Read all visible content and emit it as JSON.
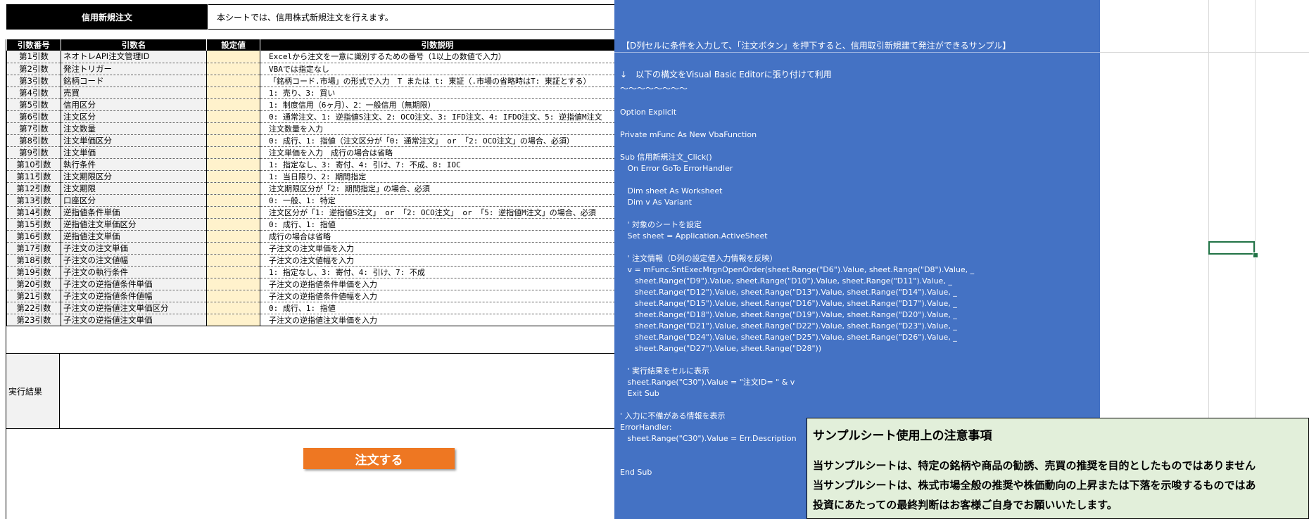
{
  "header": {
    "title": "信用新規注文",
    "description": "本シートでは、信用株式新規注文を行えます。"
  },
  "table": {
    "columns": [
      "引数番号",
      "引数名",
      "設定値",
      "引数説明"
    ],
    "rows": [
      {
        "num": "第1引数",
        "name": "ネオトレAPI注文管理ID",
        "value": "",
        "desc": "Excelから注文を一意に識別するための番号（1以上の数値で入力）"
      },
      {
        "num": "第2引数",
        "name": "発注トリガー",
        "value": "",
        "desc": "VBAでは指定なし"
      },
      {
        "num": "第3引数",
        "name": "銘柄コード",
        "value": "",
        "desc": "「銘柄コード.市場」の形式で入力　T または t: 東証（.市場の省略時はT: 東証とする）"
      },
      {
        "num": "第4引数",
        "name": "売買",
        "value": "",
        "desc": "1: 売り、3: 買い"
      },
      {
        "num": "第5引数",
        "name": "信用区分",
        "value": "",
        "desc": "1: 制度信用（6ヶ月）、2：一般信用（無期限）"
      },
      {
        "num": "第6引数",
        "name": "注文区分",
        "value": "",
        "desc": "0: 通常注文、1: 逆指値S注文、2: OCO注文、3: IFD注文、4: IFDO注文、5: 逆指値M注文"
      },
      {
        "num": "第7引数",
        "name": "注文数量",
        "value": "",
        "desc": "注文数量を入力"
      },
      {
        "num": "第8引数",
        "name": "注文単価区分",
        "value": "",
        "desc": "0: 成行、1: 指値（注文区分が「0: 通常注文」 or 「2: OCO注文」の場合、必須）"
      },
      {
        "num": "第9引数",
        "name": "注文単価",
        "value": "",
        "desc": "注文単価を入力　成行の場合は省略"
      },
      {
        "num": "第10引数",
        "name": "執行条件",
        "value": "",
        "desc": "1: 指定なし、3: 寄付、4: 引け、7: 不成、8: IOC"
      },
      {
        "num": "第11引数",
        "name": "注文期限区分",
        "value": "",
        "desc": "1: 当日限り、2: 期間指定"
      },
      {
        "num": "第12引数",
        "name": "注文期限",
        "value": "",
        "desc": "注文期限区分が「2: 期間指定」の場合、必須"
      },
      {
        "num": "第13引数",
        "name": "口座区分",
        "value": "",
        "desc": "0: 一般、1: 特定"
      },
      {
        "num": "第14引数",
        "name": "逆指値条件単価",
        "value": "",
        "desc": "注文区分が「1: 逆指値S注文」 or 「2: OCO注文」 or 「5: 逆指値M注文」の場合、必須"
      },
      {
        "num": "第15引数",
        "name": "逆指値注文単価区分",
        "value": "",
        "desc": "0: 成行、1: 指値"
      },
      {
        "num": "第16引数",
        "name": "逆指値注文単価",
        "value": "",
        "desc": "成行の場合は省略"
      },
      {
        "num": "第17引数",
        "name": "子注文の注文単価",
        "value": "",
        "desc": "子注文の注文単価を入力"
      },
      {
        "num": "第18引数",
        "name": "子注文の注文値幅",
        "value": "",
        "desc": "子注文の注文値幅を入力"
      },
      {
        "num": "第19引数",
        "name": "子注文の執行条件",
        "value": "",
        "desc": "1: 指定なし、3: 寄付、4: 引け、7: 不成"
      },
      {
        "num": "第20引数",
        "name": "子注文の逆指値条件単価",
        "value": "",
        "desc": "子注文の逆指値条件単価を入力"
      },
      {
        "num": "第21引数",
        "name": "子注文の逆指値条件値幅",
        "value": "",
        "desc": "子注文の逆指値条件値幅を入力"
      },
      {
        "num": "第22引数",
        "name": "子注文の逆指値注文単価区分",
        "value": "",
        "desc": "0: 成行、1: 指値"
      },
      {
        "num": "第23引数",
        "name": "子注文の逆指値注文単価",
        "value": "",
        "desc": "子注文の逆指値注文単価を入力"
      }
    ]
  },
  "result": {
    "label": "実行結果",
    "value": ""
  },
  "order_button": {
    "label": "注文する"
  },
  "code_panel": {
    "banner": "【D列セルに条件を入力して、「注文ボタン」を押下すると、信用取引新規建て発注ができるサンプル】",
    "intro_line1": "↓　以下の構文をVisual Basic Editorに張り付けて利用",
    "intro_line2": "〜〜〜〜〜〜〜〜",
    "code": "Option Explicit\n\nPrivate mFunc As New VbaFunction\n\nSub 信用新規注文_Click()\n   On Error GoTo ErrorHandler\n\n   Dim sheet As Worksheet\n   Dim v As Variant\n\n   ' 対象のシートを設定\n   Set sheet = Application.ActiveSheet\n\n   ' 注文情報（D列の設定値入力情報を反映）\n   v = mFunc.SntExecMrgnOpenOrder(sheet.Range(\"D6\").Value, sheet.Range(\"D8\").Value, _\n      sheet.Range(\"D9\").Value, sheet.Range(\"D10\").Value, sheet.Range(\"D11\").Value, _\n      sheet.Range(\"D12\").Value, sheet.Range(\"D13\").Value, sheet.Range(\"D14\").Value, _\n      sheet.Range(\"D15\").Value, sheet.Range(\"D16\").Value, sheet.Range(\"D17\").Value, _\n      sheet.Range(\"D18\").Value, sheet.Range(\"D19\").Value, sheet.Range(\"D20\").Value, _\n      sheet.Range(\"D21\").Value, sheet.Range(\"D22\").Value, sheet.Range(\"D23\").Value, _\n      sheet.Range(\"D24\").Value, sheet.Range(\"D25\").Value, sheet.Range(\"D26\").Value, _\n      sheet.Range(\"D27\").Value, sheet.Range(\"D28\"))\n\n   ' 実行結果をセルに表示\n   sheet.Range(\"C30\").Value = \"注文ID= \" & v\n   Exit Sub\n\n' 入力に不備がある情報を表示\nErrorHandler:\n   sheet.Range(\"C30\").Value = Err.Description\n\n\nEnd Sub"
  },
  "notice": {
    "title": "サンプルシート使用上の注意事項",
    "lines": [
      "当サンプルシートは、特定の銘柄や商品の勧誘、売買の推奨を目的としたものではありません",
      "当サンプルシートは、株式市場全般の推奨や株価動向の上昇または下落を示唆するものではあ",
      "投資にあたっての最終判断はお客様ご自身でお願いいたします。"
    ]
  },
  "colors": {
    "code_panel_bg": "#4472c4",
    "input_cell_bg": "#fff2cc",
    "button_bg": "#ee7722",
    "notice_bg": "#e2efda",
    "selection_border": "#217346"
  }
}
